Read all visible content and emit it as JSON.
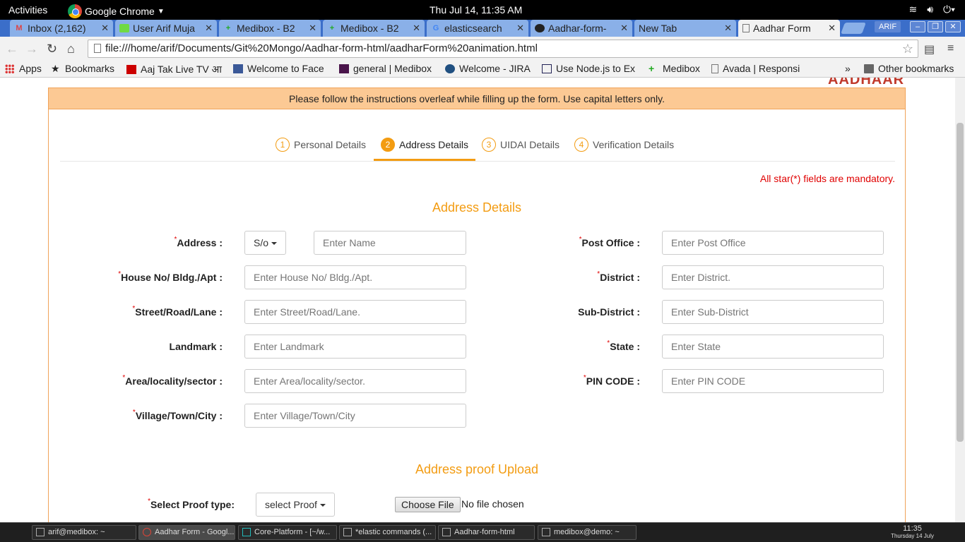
{
  "topbar": {
    "activities": "Activities",
    "app": "Google Chrome",
    "clock": "Thu Jul 14, 11:35 AM"
  },
  "tabs": [
    {
      "label": "Inbox (2,162)",
      "icon": "gmail-icon"
    },
    {
      "label": "User Arif Muja",
      "icon": "upwork-icon"
    },
    {
      "label": "Medibox - B2",
      "icon": "medibox-icon"
    },
    {
      "label": "Medibox - B2",
      "icon": "medibox-icon"
    },
    {
      "label": "elasticsearch",
      "icon": "google-icon"
    },
    {
      "label": "Aadhar-form-",
      "icon": "github-icon"
    },
    {
      "label": "New Tab",
      "icon": ""
    },
    {
      "label": "Aadhar Form",
      "icon": "page-icon"
    }
  ],
  "profile": "ARIF",
  "url": "file:///home/arif/Documents/Git%20Mongo/Aadhar-form-html/aadharForm%20animation.html",
  "bookmarks": [
    {
      "label": "Apps",
      "icon": "apps-icon"
    },
    {
      "label": "Bookmarks",
      "icon": "star-icon"
    },
    {
      "label": "Aaj Tak Live TV आ",
      "icon": "aajtak-icon"
    },
    {
      "label": "Welcome to Face",
      "icon": "facebook-icon"
    },
    {
      "label": "general | Medibox",
      "icon": "slack-icon"
    },
    {
      "label": "Welcome - JIRA",
      "icon": "jira-icon"
    },
    {
      "label": "Use Node.js to Ex",
      "icon": "grid-icon"
    },
    {
      "label": "Medibox",
      "icon": "medibox-icon"
    },
    {
      "label": "Avada | Responsi",
      "icon": "page-icon"
    }
  ],
  "other_bookmarks": "Other bookmarks",
  "page": {
    "logo": "AADHAAR",
    "notice": "Please follow the instructions overleaf while filling up the form. Use capital letters only.",
    "steps": [
      {
        "num": "1",
        "label": "Personal Details"
      },
      {
        "num": "2",
        "label": "Address Details"
      },
      {
        "num": "3",
        "label": "UIDAI Details"
      },
      {
        "num": "4",
        "label": "Verification Details"
      }
    ],
    "mandatory_note": "All star(*) fields are mandatory.",
    "section_title": "Address Details",
    "relation_select": "S/o",
    "fields": {
      "address": {
        "label": "Address :",
        "placeholder": "Enter Name"
      },
      "house": {
        "label": "House No/ Bldg./Apt :",
        "placeholder": "Enter House No/ Bldg./Apt."
      },
      "street": {
        "label": "Street/Road/Lane :",
        "placeholder": "Enter Street/Road/Lane."
      },
      "landmark": {
        "label": "Landmark :",
        "placeholder": "Enter Landmark"
      },
      "area": {
        "label": "Area/locality/sector :",
        "placeholder": "Enter Area/locality/sector."
      },
      "village": {
        "label": "Village/Town/City :",
        "placeholder": "Enter Village/Town/City"
      },
      "post_office": {
        "label": "Post Office :",
        "placeholder": "Enter Post Office"
      },
      "district": {
        "label": "District :",
        "placeholder": "Enter District."
      },
      "sub_district": {
        "label": "Sub-District :",
        "placeholder": "Enter Sub-District"
      },
      "state": {
        "label": "State :",
        "placeholder": "Enter State"
      },
      "pin": {
        "label": "PIN CODE :",
        "placeholder": "Enter PIN CODE"
      }
    },
    "upload_title": "Address proof Upload",
    "proof_label": "Select Proof type:",
    "proof_select": "select Proof",
    "choose_file": "Choose File",
    "no_file": "No file chosen"
  },
  "taskbar": [
    {
      "label": "arif@medibox: ~"
    },
    {
      "label": "Aadhar Form - Googl..."
    },
    {
      "label": "Core-Platform - [~/w..."
    },
    {
      "label": "*elastic commands (..."
    },
    {
      "label": "Aadhar-form-html"
    },
    {
      "label": "medibox@demo: ~"
    }
  ],
  "task_clock": {
    "time": "11:35",
    "date": "Thursday 14 July"
  }
}
